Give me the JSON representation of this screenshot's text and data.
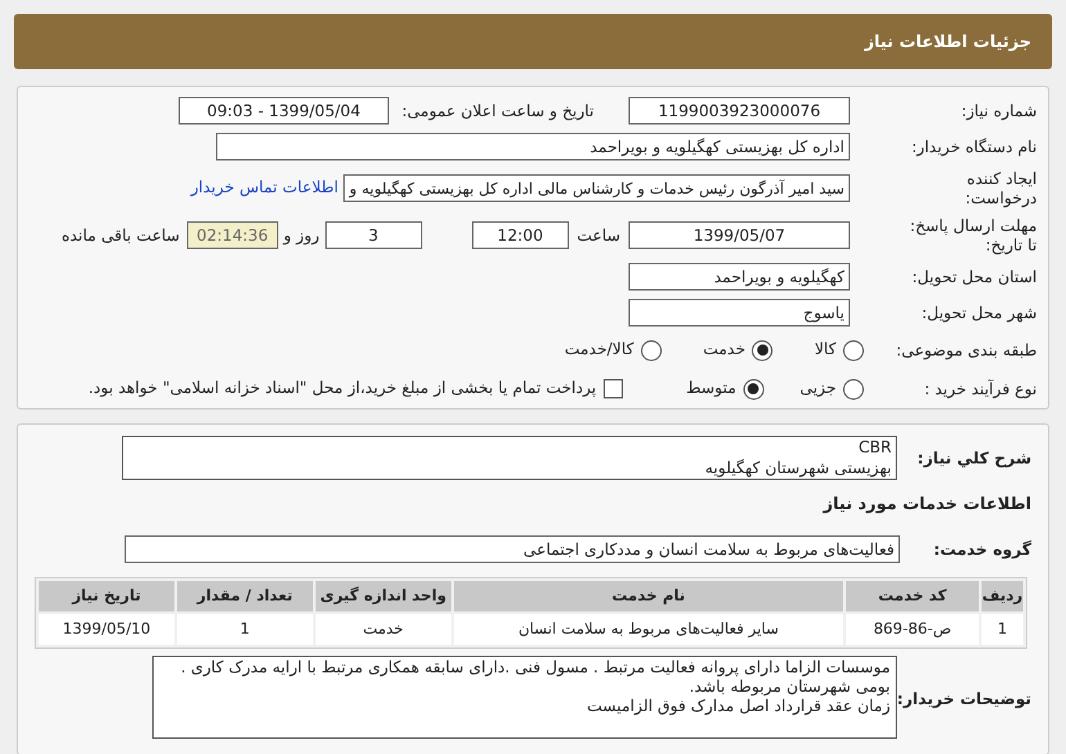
{
  "header": {
    "title": "جزئیات اطلاعات نیاز"
  },
  "details": {
    "need_number": {
      "label": "شماره نیاز:",
      "value": "1199003923000076"
    },
    "announce": {
      "label": "تاریخ و ساعت اعلان عمومی:",
      "value": "1399/05/04 - 09:03"
    },
    "buyer": {
      "label": "نام دستگاه خریدار:",
      "value": "اداره کل بهزیستی کهگیلویه و بویراحمد"
    },
    "creator": {
      "label": "ایجاد کننده درخواست:",
      "value": "سید امیر آذرگون رئیس خدمات و کارشناس مالی اداره کل بهزیستی کهگیلویه و",
      "link": "اطلاعات تماس خریدار"
    },
    "deadline": {
      "label": "مهلت ارسال پاسخ: تا تاریخ:",
      "date": "1399/05/07",
      "time_label": "ساعت",
      "time": "12:00",
      "days": "3",
      "days_label": "روز و",
      "remaining": "02:14:36",
      "remaining_label": "ساعت باقی مانده"
    },
    "province": {
      "label": "استان محل تحویل:",
      "value": "کهگیلویه و بویراحمد"
    },
    "city": {
      "label": "شهر محل تحویل:",
      "value": "یاسوج"
    },
    "category": {
      "label": "طبقه بندی موضوعی:",
      "options": [
        {
          "label": "کالا",
          "selected": false
        },
        {
          "label": "خدمت",
          "selected": true
        },
        {
          "label": "کالا/خدمت",
          "selected": false
        }
      ]
    },
    "process": {
      "label": "نوع فرآیند خرید :",
      "options": [
        {
          "label": "جزیی",
          "selected": false
        },
        {
          "label": "متوسط",
          "selected": true
        }
      ],
      "treasury": {
        "checked": false,
        "text": "پرداخت تمام یا بخشی از مبلغ خرید،از محل \"اسناد خزانه اسلامی\" خواهد بود."
      }
    }
  },
  "summary": {
    "label": "شرح كلي نياز:",
    "lines": [
      "CBR",
      "بهزیستی شهرستان کهگیلویه"
    ]
  },
  "services": {
    "heading": "اطلاعات خدمات مورد نیاز",
    "group_label": "گروه خدمت:",
    "group": "فعالیت‌های مربوط به سلامت انسان و مددکاری اجتماعی",
    "table": {
      "columns": [
        "ردیف",
        "کد خدمت",
        "نام خدمت",
        "واحد اندازه گیری",
        "تعداد / مقدار",
        "تاریخ نیاز"
      ],
      "rows": [
        [
          "1",
          "ص-86-869",
          "سایر فعالیت‌های مربوط به سلامت انسان",
          "خدمت",
          "1",
          "1399/05/10"
        ]
      ]
    }
  },
  "notes": {
    "label": "توضیحات خریدار:",
    "lines": [
      "موسسات الزاما دارای پروانه فعالیت مرتبط .  مسول فنی  .دارای سابقه همکاری مرتبط با ارایه مدرک کاری  . بومی شهرستان مربوطه باشد.",
      "زمان عقد قرارداد اصل مدارک فوق الزامیست"
    ]
  }
}
